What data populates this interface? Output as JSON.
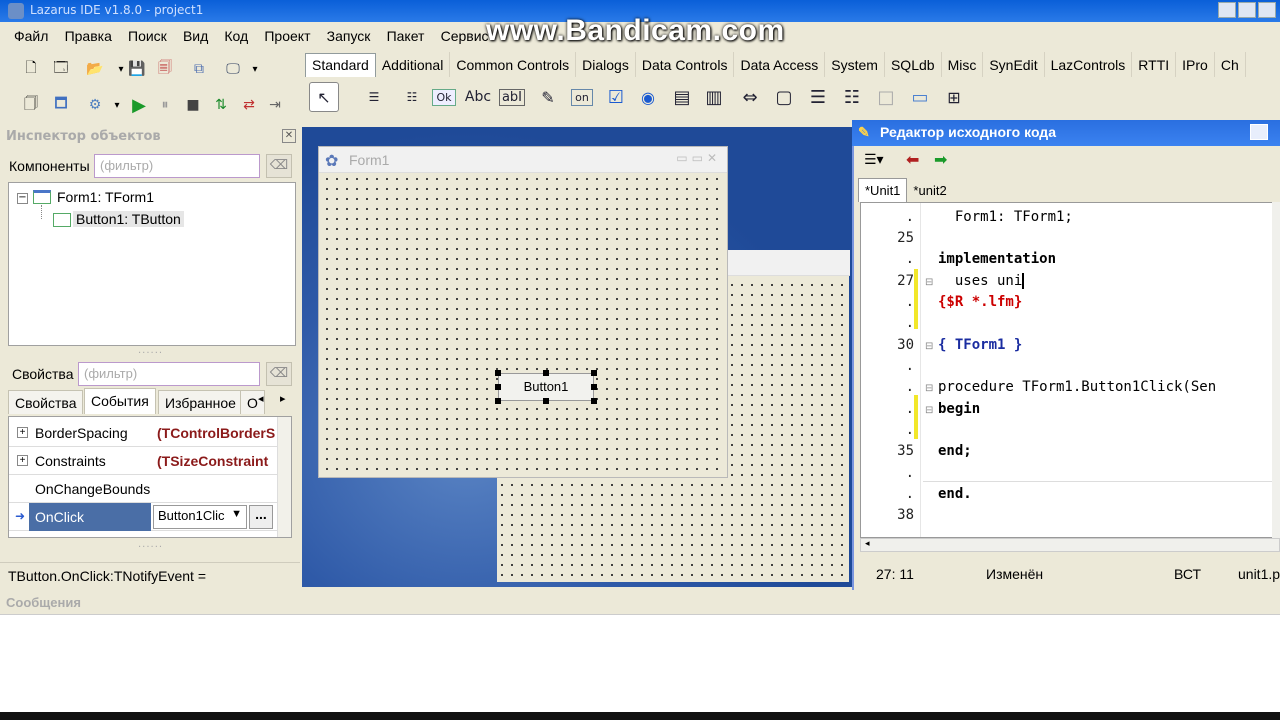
{
  "window": {
    "title": "Lazarus IDE v1.8.0 - project1"
  },
  "watermark": "www.Bandicam.com",
  "menu": [
    "Файл",
    "Правка",
    "Поиск",
    "Вид",
    "Код",
    "Проект",
    "Запуск",
    "Пакет",
    "Сервис"
  ],
  "palette": {
    "tabs": [
      "Standard",
      "Additional",
      "Common Controls",
      "Dialogs",
      "Data Controls",
      "Data Access",
      "System",
      "SQLdb",
      "Misc",
      "SynEdit",
      "LazControls",
      "RTTI",
      "IPro",
      "Ch"
    ],
    "button_captions": {
      "ok": "Ok",
      "abc": "Abc",
      "ab_edit": "abI",
      "on": "on"
    }
  },
  "inspector": {
    "title": "Инспектор объектов",
    "components_label": "Компоненты",
    "components_filter_placeholder": "(фильтр)",
    "tree": [
      {
        "label": "Form1: TForm1"
      },
      {
        "label": "Button1: TButton"
      }
    ],
    "properties_label": "Свойства",
    "properties_filter_placeholder": "(фильтр)",
    "tabs": [
      "Свойства",
      "События",
      "Избранное",
      "О"
    ],
    "rows": [
      {
        "name": "BorderSpacing",
        "value": "(TControlBorderS",
        "expandable": true
      },
      {
        "name": "Constraints",
        "value": "(TSizeConstraint",
        "expandable": true
      },
      {
        "name": "OnChangeBounds",
        "value": "",
        "expandable": false
      },
      {
        "name": "OnClick",
        "value": "Button1Clic",
        "expandable": false,
        "selected": true
      }
    ],
    "ellipsis": "...",
    "status": "TButton.OnClick:TNotifyEvent ="
  },
  "designer": {
    "form_title": "Form1",
    "button_caption": "Button1"
  },
  "editor": {
    "title": "Редактор исходного кода",
    "tabs": [
      "*Unit1",
      "*unit2"
    ],
    "lines": [
      {
        "num": ".",
        "text": "  Form1: TForm1;"
      },
      {
        "num": "25",
        "text": ""
      },
      {
        "num": ".",
        "text": "implementation"
      },
      {
        "num": "27",
        "text": "  uses uni"
      },
      {
        "num": ".",
        "text": "{$R *.lfm}"
      },
      {
        "num": ".",
        "text": ""
      },
      {
        "num": "30",
        "text": "{ TForm1 }"
      },
      {
        "num": ".",
        "text": ""
      },
      {
        "num": ".",
        "text": "procedure TForm1.Button1Click(Sen"
      },
      {
        "num": ".",
        "text": "begin"
      },
      {
        "num": ".",
        "text": ""
      },
      {
        "num": "35",
        "text": "end;"
      },
      {
        "num": ".",
        "text": ""
      },
      {
        "num": ".",
        "text": "end."
      },
      {
        "num": "38",
        "text": ""
      }
    ],
    "status": {
      "position": "27: 11",
      "modified": "Изменён",
      "mode": "ВСТ",
      "file": "unit1.p"
    }
  },
  "messages": {
    "title": "Сообщения"
  }
}
